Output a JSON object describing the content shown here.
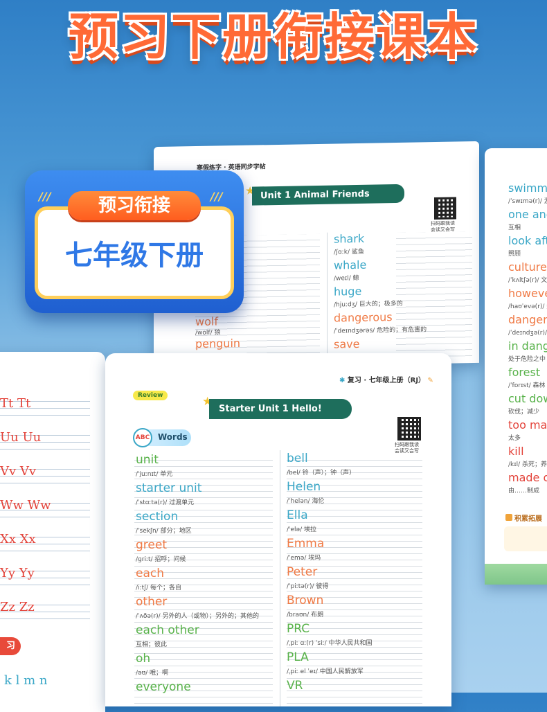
{
  "headline": "预习下册衔接课本",
  "badge": {
    "top": "预习衔接",
    "main": "七年级下册",
    "dashes_left": "///",
    "dashes_right": "///"
  },
  "back_book": {
    "header": "寒假练字 · 英语同步字帖",
    "unit_title": "Unit 1   Animal Friends",
    "qr_caption": "扫码跟我读\n会读又会写",
    "left_words": [
      {
        "word": "wolf",
        "phonetic": "/wolf/  狼",
        "color": "orange"
      },
      {
        "word": "penguin",
        "phonetic": "",
        "color": "orange"
      }
    ],
    "right_words": [
      {
        "word": "shark",
        "phonetic": "/ʃɑːk/  鲨鱼",
        "color": "teal"
      },
      {
        "word": "whale",
        "phonetic": "/weɪl/  鲸",
        "color": "teal"
      },
      {
        "word": "huge",
        "phonetic": "/hjuːdʒ/  巨大的；极多的",
        "color": "teal"
      },
      {
        "word": "dangerous",
        "phonetic": "/ˈdeɪndʒərəs/  危险的；有危害的",
        "color": "orange"
      },
      {
        "word": "save",
        "phonetic": "",
        "color": "orange"
      }
    ]
  },
  "right_book": {
    "words": [
      {
        "word": "swimmer",
        "phonetic": "/ˈswɪmə(r)/  游泳",
        "color": "teal"
      },
      {
        "word": "one anot",
        "phonetic": "互相",
        "color": "teal"
      },
      {
        "word": "look afte",
        "phonetic": "照顾",
        "color": "teal"
      },
      {
        "word": "culture",
        "phonetic": "/ˈkʌltʃə(r)/  文化",
        "color": "orange"
      },
      {
        "word": "however",
        "phonetic": "/haʊˈevə(r)/  然而",
        "color": "orange"
      },
      {
        "word": "danger",
        "phonetic": "/ˈdeɪndʒə(r)/  危险",
        "color": "orange"
      },
      {
        "word": "in dange",
        "phonetic": "处于危险之中",
        "color": "green"
      },
      {
        "word": "forest",
        "phonetic": "/ˈfɒrɪst/  森林",
        "color": "green"
      },
      {
        "word": "cut down",
        "phonetic": "砍伐；减少",
        "color": "green"
      },
      {
        "word": "too many",
        "phonetic": "太多",
        "color": "red"
      },
      {
        "word": "kill",
        "phonetic": "/kɪl/  杀死；养死",
        "color": "red"
      },
      {
        "word": "made of",
        "phonetic": "由……制成",
        "color": "red"
      }
    ],
    "footer_label": "积累拓展"
  },
  "left_book": {
    "rows": [
      "Tt  Tt",
      "Uu  Uu",
      "Vv  Vv",
      "Ww  Ww",
      "Xx  Xx",
      "Yy  Yy",
      "Zz  Zz"
    ],
    "tab": "习",
    "bottom_letters": "k  l  m  n"
  },
  "front_book": {
    "header": "复习 · 七年级上册（RJ）",
    "review_tag": "Review",
    "unit_title": "Starter Unit 1     Hello!",
    "section_label": "Words",
    "abc_icon": "ABC",
    "qr_caption": "扫码跟我读\n会读又会写",
    "left_words": [
      {
        "word": "unit",
        "phonetic": "/ˈjuːnɪt/  单元",
        "color": "green"
      },
      {
        "word": "starter unit",
        "phonetic": "/ˈstɑːtə(r)/  过渡单元",
        "color": "teal"
      },
      {
        "word": "section",
        "phonetic": "/ˈsekʃn/  部分；地区",
        "color": "teal"
      },
      {
        "word": "greet",
        "phonetic": "/ɡriːt/  招呼；问候",
        "color": "orange"
      },
      {
        "word": "each",
        "phonetic": "/iːtʃ/  每个；各自",
        "color": "orange"
      },
      {
        "word": "other",
        "phonetic": "/ˈʌðə(r)/  另外的人（或物）；另外的；其他的",
        "color": "orange"
      },
      {
        "word": "each other",
        "phonetic": "互相；彼此",
        "color": "green"
      },
      {
        "word": "oh",
        "phonetic": "/əʊ/  哦；啊",
        "color": "green"
      },
      {
        "word": "everyone",
        "phonetic": "",
        "color": "green"
      }
    ],
    "right_words": [
      {
        "word": "bell",
        "phonetic": "/bel/  铃（声）；钟（声）",
        "color": "teal"
      },
      {
        "word": "Helen",
        "phonetic": "/ˈhelən/  海伦",
        "color": "teal"
      },
      {
        "word": "Ella",
        "phonetic": "/ˈelə/  埃拉",
        "color": "teal"
      },
      {
        "word": "Emma",
        "phonetic": "/ˈemə/  埃玛",
        "color": "orange"
      },
      {
        "word": "Peter",
        "phonetic": "/ˈpiːtə(r)/  彼得",
        "color": "orange"
      },
      {
        "word": "Brown",
        "phonetic": "/braʊn/  布朗",
        "color": "orange"
      },
      {
        "word": "PRC",
        "phonetic": "/ˌpiː ɑː(r) ˈsiː/  中华人民共和国",
        "color": "green"
      },
      {
        "word": "PLA",
        "phonetic": "/ˌpiː el ˈeɪ/  中国人民解放军",
        "color": "green"
      },
      {
        "word": "VR",
        "phonetic": "",
        "color": "green"
      }
    ]
  },
  "colors": {
    "teal": "#3aa7c7",
    "green": "#58b24a",
    "orange": "#f07a45",
    "red": "#e3433a",
    "banner": "#1e6e5c",
    "badge_blue": "#2f78e6",
    "badge_orange": "#ff6a2a"
  }
}
